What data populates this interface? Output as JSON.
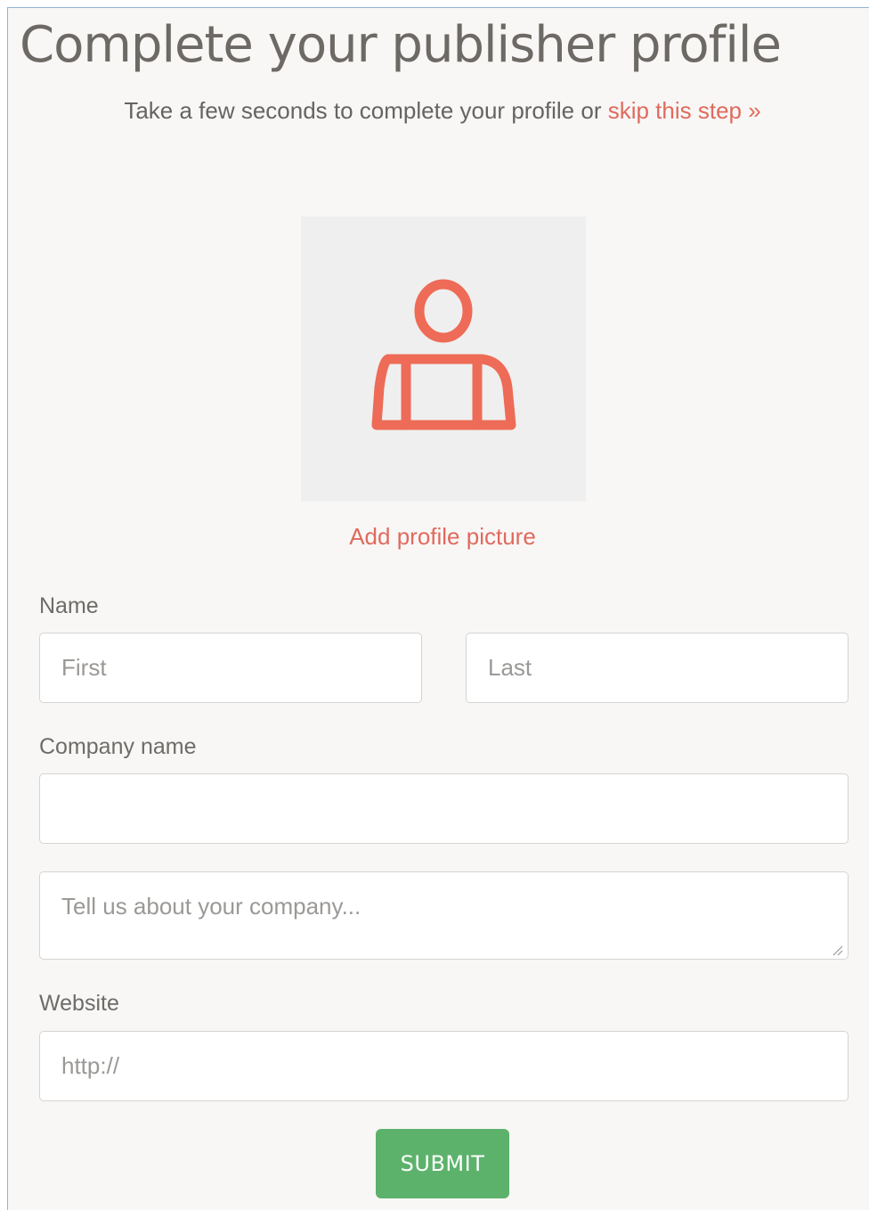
{
  "header": {
    "title": "Complete your publisher profile",
    "subtitle_prefix": "Take a few seconds to complete your profile or ",
    "skip_link": "skip this step »"
  },
  "profile_picture": {
    "icon": "user-silhouette-icon",
    "add_label": "Add profile picture"
  },
  "form": {
    "name_label": "Name",
    "first_placeholder": "First",
    "last_placeholder": "Last",
    "company_label": "Company name",
    "company_value": "",
    "about_placeholder": "Tell us about your company...",
    "website_label": "Website",
    "website_placeholder": "http://",
    "submit_label": "SUBMIT"
  },
  "colors": {
    "accent": "#e06a5d",
    "submit": "#5cb26b",
    "background": "#f8f7f6",
    "text": "#6d6a65"
  }
}
